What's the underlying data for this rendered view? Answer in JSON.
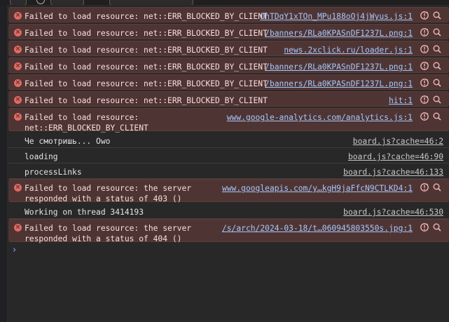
{
  "colors": {
    "background": "#282828",
    "error_background": "#4e3534",
    "error_icon": "#e46962",
    "link": "#a8c7fa",
    "prompt": "#7cacf8"
  },
  "icons": {
    "error": "error-circle-icon",
    "ai": "ai-explain-icon",
    "search": "search-icon",
    "prompt": "chevron-right-icon"
  },
  "entries": [
    {
      "level": "error",
      "message": "Failed to load resource: net::ERR_BLOCKED_BY_CLIENT",
      "source": "OhTDqY1xTOn_MPu188oOj4jWyus.js:1"
    },
    {
      "level": "error",
      "message": "Failed to load resource: net::ERR_BLOCKED_BY_CLIENT",
      "source": "/banners/RLa0KPASnDF1237L.png:1"
    },
    {
      "level": "error",
      "message": "Failed to load resource: net::ERR_BLOCKED_BY_CLIENT",
      "source": "news.2xclick.ru/loader.js:1"
    },
    {
      "level": "error",
      "message": "Failed to load resource: net::ERR_BLOCKED_BY_CLIENT",
      "source": "/banners/RLa0KPASnDF1237L.png:1"
    },
    {
      "level": "error",
      "message": "Failed to load resource: net::ERR_BLOCKED_BY_CLIENT",
      "source": "/banners/RLa0KPASnDF1237L.png:1"
    },
    {
      "level": "error",
      "message": "Failed to load resource: net::ERR_BLOCKED_BY_CLIENT",
      "source": "hit:1"
    },
    {
      "level": "error",
      "message": "Failed to load resource:\nnet::ERR_BLOCKED_BY_CLIENT",
      "source": "www.google-analytics.com/analytics.js:1"
    },
    {
      "level": "info",
      "message": "Че смотришь... Owo",
      "source": "board.js?cache=46:2"
    },
    {
      "level": "info",
      "message": "loading",
      "source": "board.js?cache=46:90"
    },
    {
      "level": "info",
      "message": "processLinks",
      "source": "board.js?cache=46:133"
    },
    {
      "level": "error",
      "message": "Failed to load resource: the server\nresponded with a status of 403 ()",
      "source": "www.googleapis.com/y…kgH9jaFfcN9CTLKD4:1"
    },
    {
      "level": "info",
      "message": "Working on thread 3414193",
      "source": "board.js?cache=46:530"
    },
    {
      "level": "error",
      "message": "Failed to load resource: the server\nresponded with a status of 404 ()",
      "source": "/s/arch/2024-03-18/t…060945803550s.jpg:1"
    }
  ],
  "prompt_symbol": "›"
}
